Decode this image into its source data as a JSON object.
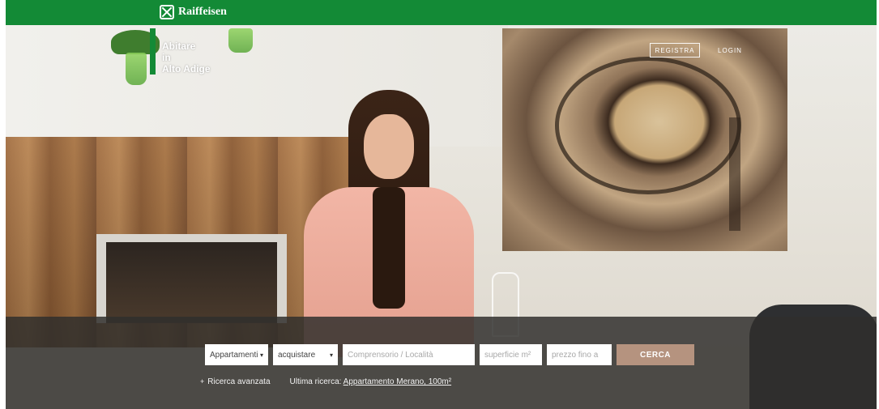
{
  "header": {
    "logo_text": "Raiffeisen",
    "brand_line1": "Abitare",
    "brand_line2": "in",
    "brand_line3": "Alto Adige",
    "register_label": "REGISTRA",
    "login_label": "LOGIN"
  },
  "search": {
    "type_value": "Appartamenti",
    "mode_value": "acquistare",
    "location_placeholder": "Comprensorio / Località",
    "area_placeholder": "superficie m²",
    "price_placeholder": "prezzo fino a",
    "submit_label": "CERCA"
  },
  "links": {
    "advanced_icon": "+",
    "advanced_label": "Ricerca avanzata",
    "last_search_prefix": "Ultima ricerca:",
    "last_search_value": "Appartamento Merano, 100m²"
  },
  "icons": {
    "logo": "raiffeisen-cross-icon",
    "caret": "chevron-down-icon"
  },
  "colors": {
    "brand_green": "#138a36",
    "cta": "#b5937f",
    "search_bg": "#302e2c"
  }
}
